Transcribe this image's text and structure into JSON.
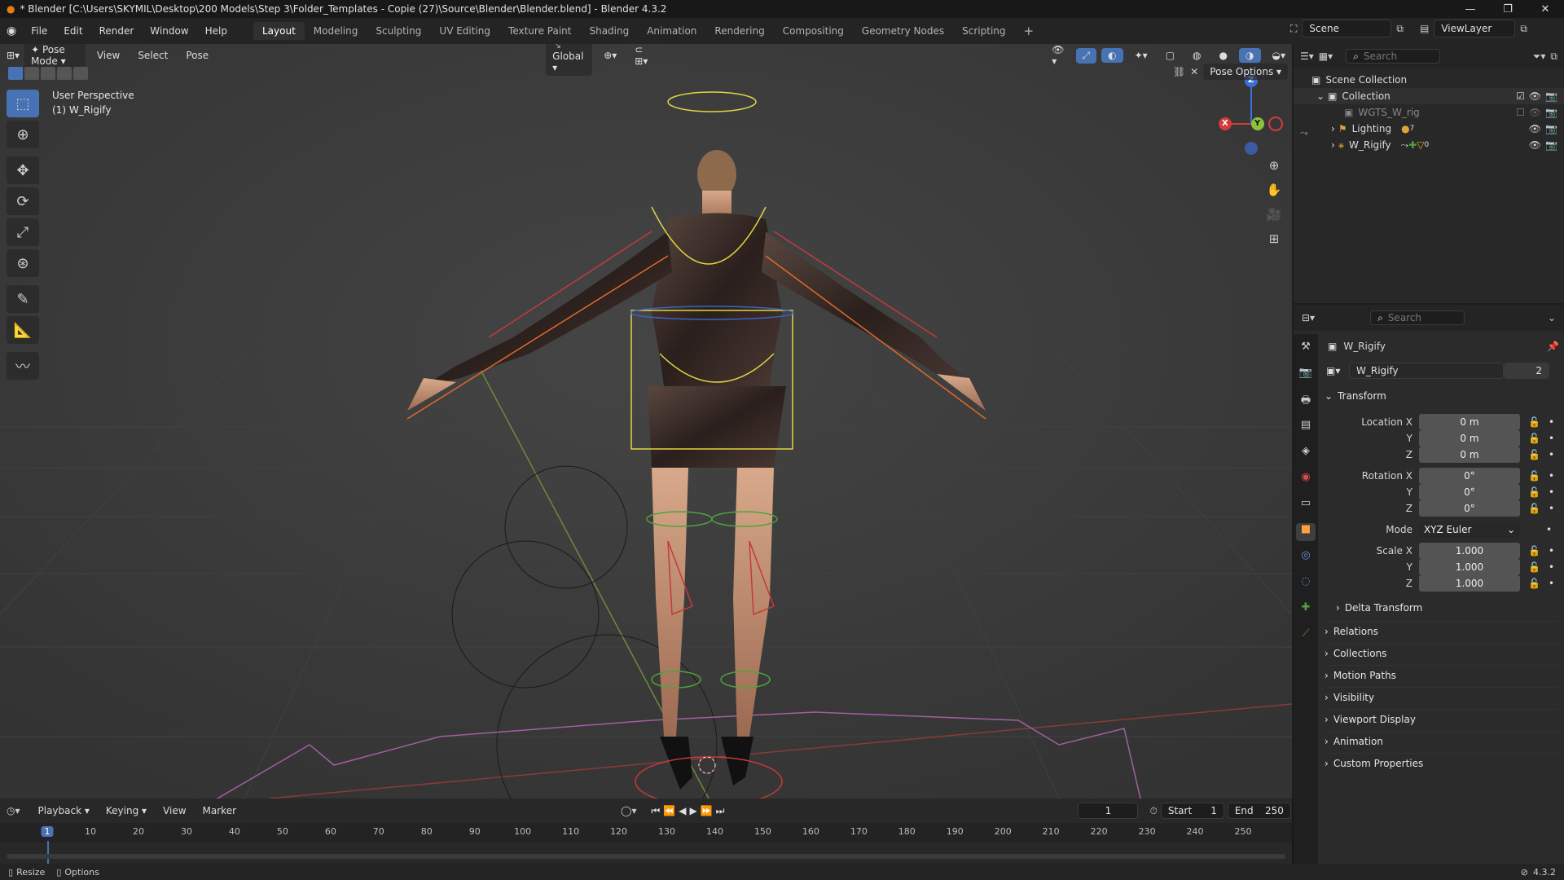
{
  "titlebar": {
    "title": "* Blender [C:\\Users\\SKYMIL\\Desktop\\200 Models\\Step 3\\Folder_Templates - Copie (27)\\Source\\Blender\\Blender.blend] - Blender 4.3.2",
    "min": "—",
    "max": "❐",
    "close": "✕"
  },
  "menu": {
    "items": [
      "File",
      "Edit",
      "Render",
      "Window",
      "Help"
    ],
    "workspaces": [
      "Layout",
      "Modeling",
      "Sculpting",
      "UV Editing",
      "Texture Paint",
      "Shading",
      "Animation",
      "Rendering",
      "Compositing",
      "Geometry Nodes",
      "Scripting"
    ],
    "add_tab": "+",
    "scene": "Scene",
    "view_layer": "ViewLayer"
  },
  "viewport": {
    "mode": "Pose Mode",
    "menus": [
      "View",
      "Select",
      "Pose"
    ],
    "transform_orientation": "Global",
    "pose_options": "Pose Options",
    "info_line1": "User Perspective",
    "info_line2": "(1) W_Rigify",
    "gizmo_axes": {
      "x": "X",
      "y": "Y",
      "z": "Z"
    }
  },
  "tools": [
    "select-box",
    "cursor",
    "move",
    "rotate",
    "scale",
    "transform",
    "annotate",
    "measure",
    "relax"
  ],
  "outliner": {
    "search_placeholder": "Search",
    "rows": [
      {
        "label": "Scene Collection",
        "indent": 0
      },
      {
        "label": "Collection",
        "indent": 1
      },
      {
        "label": "WGTS_W_rig",
        "indent": 2
      },
      {
        "label": "Lighting",
        "indent": 2,
        "badge": "7"
      },
      {
        "label": "W_Rigify",
        "indent": 2,
        "badge": "0"
      }
    ]
  },
  "properties": {
    "search_placeholder": "Search",
    "object_name": "W_Rigify",
    "data_name": "W_Rigify",
    "users": "2",
    "transform_header": "Transform",
    "location": {
      "label_x": "Location X",
      "label_y": "Y",
      "label_z": "Z",
      "x": "0 m",
      "y": "0 m",
      "z": "0 m"
    },
    "rotation": {
      "label_x": "Rotation X",
      "label_y": "Y",
      "label_z": "Z",
      "x": "0°",
      "y": "0°",
      "z": "0°"
    },
    "mode_label": "Mode",
    "mode_value": "XYZ Euler",
    "scale": {
      "label_x": "Scale X",
      "label_y": "Y",
      "label_z": "Z",
      "x": "1.000",
      "y": "1.000",
      "z": "1.000"
    },
    "delta_transform": "Delta Transform",
    "sections": [
      "Relations",
      "Collections",
      "Motion Paths",
      "Visibility",
      "Viewport Display",
      "Animation",
      "Custom Properties"
    ]
  },
  "timeline": {
    "menus": [
      "Playback",
      "Keying",
      "View",
      "Marker"
    ],
    "current_frame": "1",
    "start_label": "Start",
    "start": "1",
    "end_label": "End",
    "end": "250",
    "ticks": [
      "1",
      "10",
      "20",
      "30",
      "40",
      "50",
      "60",
      "70",
      "80",
      "90",
      "100",
      "110",
      "120",
      "130",
      "140",
      "150",
      "160",
      "170",
      "180",
      "190",
      "200",
      "210",
      "220",
      "230",
      "240",
      "250"
    ]
  },
  "statusbar": {
    "resize": "Resize",
    "options": "Options",
    "version": "4.3.2"
  }
}
